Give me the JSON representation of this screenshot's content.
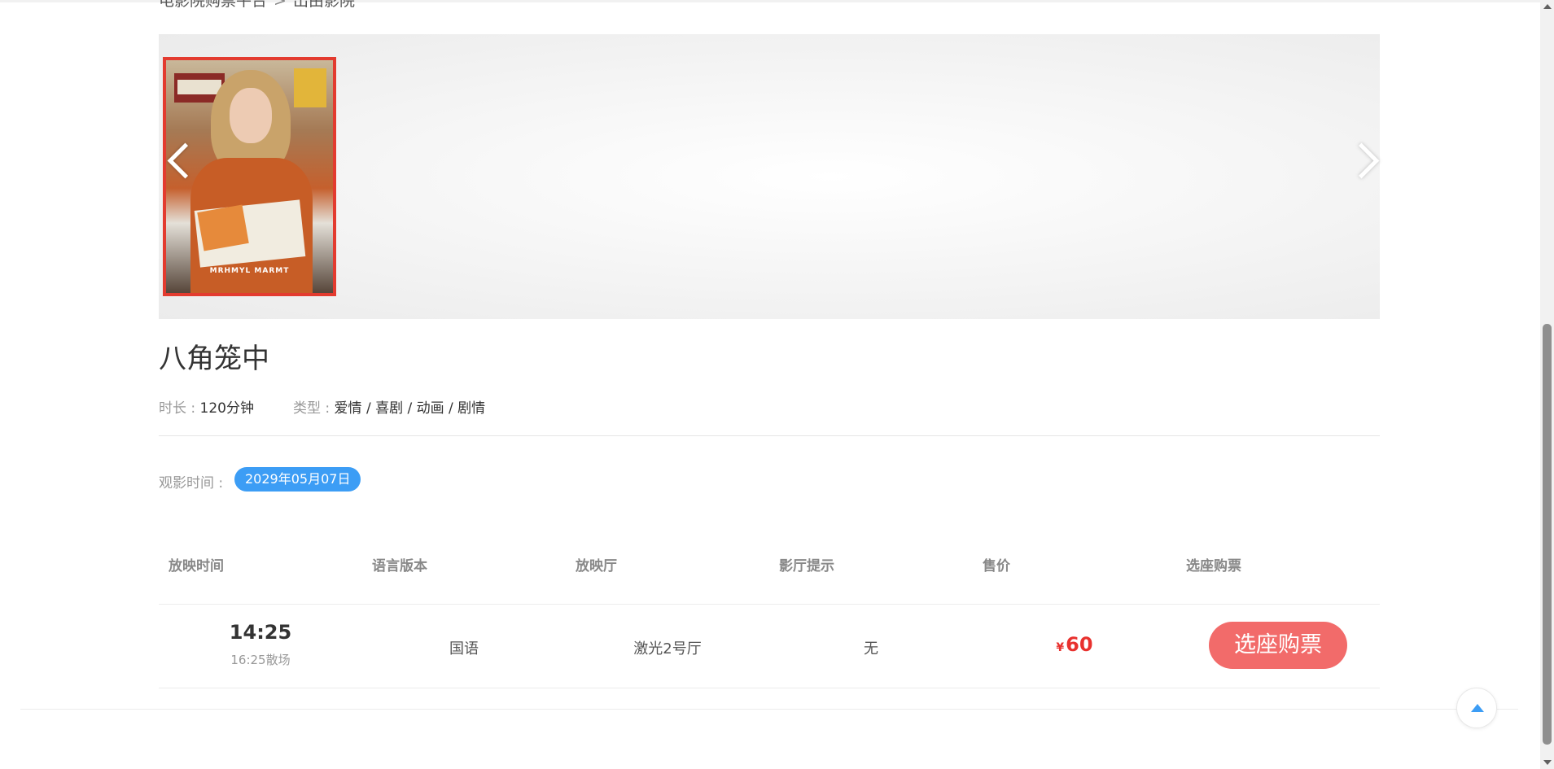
{
  "breadcrumb": {
    "home": "电影院购票平台",
    "separator": ">",
    "current": "出由影院"
  },
  "poster": {
    "caption": "MRHMYL MARMT"
  },
  "movie": {
    "title": "八角笼中",
    "duration_label": "时长 : ",
    "duration_value": "120分钟",
    "genre_label": "类型 : ",
    "genre_value": "爱情 / 喜剧 / 动画 / 剧情"
  },
  "watch": {
    "label": "观影时间 :",
    "date": "2029年05月07日"
  },
  "table": {
    "headers": [
      "放映时间",
      "语言版本",
      "放映厅",
      "影厅提示",
      "售价",
      "选座购票"
    ],
    "rows": [
      {
        "start": "14:25",
        "end": "16:25散场",
        "language": "国语",
        "hall": "激光2号厅",
        "tip": "无",
        "currency": "¥",
        "price": "60",
        "buy_label": "选座购票"
      }
    ]
  },
  "colors": {
    "accent_blue": "#3c9df5",
    "price_red": "#e8312e",
    "buy_button": "#f26b6a",
    "poster_border": "#e33b2f"
  },
  "icons": {
    "prev": "chevron-left-icon",
    "next": "chevron-right-icon",
    "back_to_top": "arrow-up-icon"
  }
}
